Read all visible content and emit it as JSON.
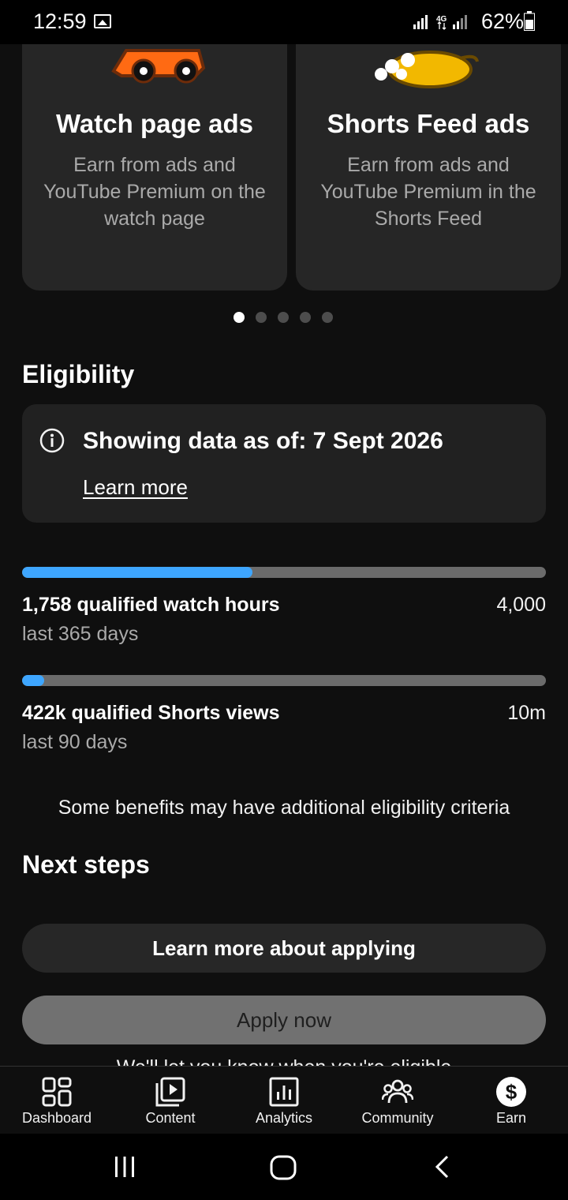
{
  "status": {
    "time": "12:59",
    "battery": "62%",
    "network": "4G"
  },
  "cards": [
    {
      "title": "Watch page ads",
      "description": "Earn from ads and YouTube Premium on the watch page"
    },
    {
      "title": "Shorts Feed ads",
      "description": "Earn from ads and YouTube Premium in the Shorts Feed"
    }
  ],
  "carousel": {
    "page_count": 5,
    "active_index": 0
  },
  "eligibility": {
    "heading": "Eligibility",
    "info_text": "Showing data as of: 7 Sept 2026",
    "info_link": "Learn more",
    "metrics": [
      {
        "label": "1,758 qualified watch hours",
        "period": "last 365 days",
        "target": "4,000",
        "progress_fraction": 0.4395
      },
      {
        "label": "422k qualified Shorts views",
        "period": "last 90 days",
        "target": "10m",
        "progress_fraction": 0.0422
      }
    ],
    "note": "Some benefits may have additional eligibility criteria"
  },
  "next_steps": {
    "heading": "Next steps",
    "learn_button": "Learn more about applying",
    "apply_button": "Apply now",
    "cut_off_text": "We'll let you know when you're eligible"
  },
  "bottom_nav": [
    {
      "label": "Dashboard",
      "icon": "dashboard-icon"
    },
    {
      "label": "Content",
      "icon": "content-icon"
    },
    {
      "label": "Analytics",
      "icon": "analytics-icon"
    },
    {
      "label": "Community",
      "icon": "community-icon"
    },
    {
      "label": "Earn",
      "icon": "earn-icon",
      "active": true
    }
  ],
  "colors": {
    "accent": "#3ea6ff",
    "background": "#0f0f0f",
    "card": "#262626"
  }
}
